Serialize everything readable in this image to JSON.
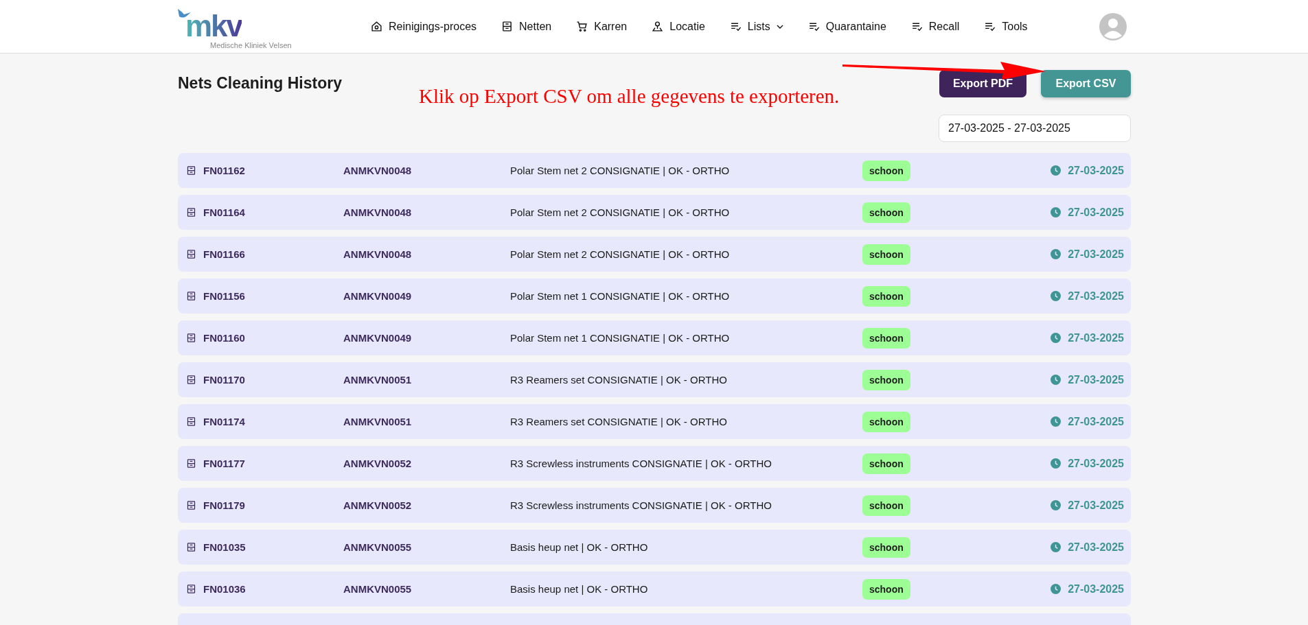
{
  "logo": {
    "text": "mkv",
    "subtitle": "Medische Kliniek Velsen"
  },
  "nav": [
    {
      "label": "Reinigings-proces",
      "dropdown": false
    },
    {
      "label": "Netten",
      "dropdown": false
    },
    {
      "label": "Karren",
      "dropdown": false
    },
    {
      "label": "Locatie",
      "dropdown": false
    },
    {
      "label": "Lists",
      "dropdown": true
    },
    {
      "label": "Quarantaine",
      "dropdown": false
    },
    {
      "label": "Recall",
      "dropdown": false
    },
    {
      "label": "Tools",
      "dropdown": false
    }
  ],
  "page_title": "Nets Cleaning History",
  "annotation": "Klik op Export CSV om alle gegevens te exporteren.",
  "buttons": [
    {
      "label": "Export PDF",
      "kind": "pdf"
    },
    {
      "label": "Export CSV",
      "kind": "csv"
    }
  ],
  "date_range": {
    "value": "27-03-2025 - 27-03-2025"
  },
  "rows": [
    {
      "id": "FN01162",
      "code": "ANMKVN0048",
      "description": "Polar Stem net 2 CONSIGNATIE | OK - ORTHO",
      "status": "schoon",
      "date": "27-03-2025"
    },
    {
      "id": "FN01164",
      "code": "ANMKVN0048",
      "description": "Polar Stem net 2 CONSIGNATIE | OK - ORTHO",
      "status": "schoon",
      "date": "27-03-2025"
    },
    {
      "id": "FN01166",
      "code": "ANMKVN0048",
      "description": "Polar Stem net 2 CONSIGNATIE | OK - ORTHO",
      "status": "schoon",
      "date": "27-03-2025"
    },
    {
      "id": "FN01156",
      "code": "ANMKVN0049",
      "description": "Polar Stem net 1 CONSIGNATIE | OK - ORTHO",
      "status": "schoon",
      "date": "27-03-2025"
    },
    {
      "id": "FN01160",
      "code": "ANMKVN0049",
      "description": "Polar Stem net 1 CONSIGNATIE | OK - ORTHO",
      "status": "schoon",
      "date": "27-03-2025"
    },
    {
      "id": "FN01170",
      "code": "ANMKVN0051",
      "description": "R3 Reamers set CONSIGNATIE | OK - ORTHO",
      "status": "schoon",
      "date": "27-03-2025"
    },
    {
      "id": "FN01174",
      "code": "ANMKVN0051",
      "description": "R3 Reamers set CONSIGNATIE | OK - ORTHO",
      "status": "schoon",
      "date": "27-03-2025"
    },
    {
      "id": "FN01177",
      "code": "ANMKVN0052",
      "description": "R3 Screwless instruments CONSIGNATIE | OK - ORTHO",
      "status": "schoon",
      "date": "27-03-2025"
    },
    {
      "id": "FN01179",
      "code": "ANMKVN0052",
      "description": "R3 Screwless instruments CONSIGNATIE | OK - ORTHO",
      "status": "schoon",
      "date": "27-03-2025"
    },
    {
      "id": "FN01035",
      "code": "ANMKVN0055",
      "description": "Basis heup net | OK - ORTHO",
      "status": "schoon",
      "date": "27-03-2025"
    },
    {
      "id": "FN01036",
      "code": "ANMKVN0055",
      "description": "Basis heup net | OK - ORTHO",
      "status": "schoon",
      "date": "27-03-2025"
    }
  ]
}
